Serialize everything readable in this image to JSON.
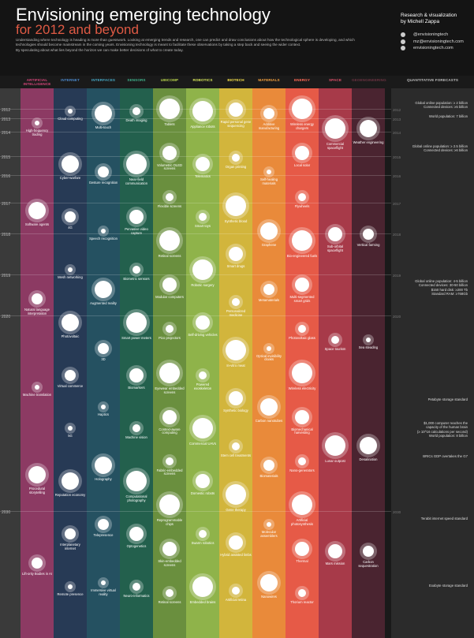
{
  "header": {
    "title": "Envisioning emerging technology",
    "subtitle": "for 2012 and beyond",
    "intro": [
      "Understanding where technology is heading is more than guesswork. Looking at emerging trends and research, one can predict and draw conclusions about how the technological sphere is developing, and which technologies should become mainstream in the coming years. Envisioning technology is meant to facilitate these observations by taking a step back and seeing the wider context.",
      "By speculating about what lies beyond the horizon we can make better decisions of what to create today."
    ],
    "credit_1": "Research & visualization",
    "credit_2": "by Michell Zappa",
    "links": [
      "@envisioningtech",
      "mz@envisioningtech.com",
      "envisioningtech.com"
    ]
  },
  "columns": [
    {
      "name": "ARTIFICIAL INTELLIGENCE",
      "color": "#8c3a63",
      "head": "#d6457a"
    },
    {
      "name": "INTERNET",
      "color": "#273a55",
      "head": "#4a86c8"
    },
    {
      "name": "INTERFACES",
      "color": "#255161",
      "head": "#45a6c2"
    },
    {
      "name": "SENSORS",
      "color": "#23604d",
      "head": "#3fb08a"
    },
    {
      "name": "UBICOMP",
      "color": "#6a8f3e",
      "head": "#b7d24b"
    },
    {
      "name": "ROBOTICS",
      "color": "#8fb34a",
      "head": "#d7e65a"
    },
    {
      "name": "BIOTECH",
      "color": "#d2b53c",
      "head": "#f5e04a"
    },
    {
      "name": "MATERIALS",
      "color": "#e98a3a",
      "head": "#f7a23e"
    },
    {
      "name": "ENERGY",
      "color": "#e65a47",
      "head": "#ff6a56"
    },
    {
      "name": "SPACE",
      "color": "#a73a49",
      "head": "#e0506a"
    },
    {
      "name": "GEOENGINEERING",
      "color": "#4a2430",
      "head": "#6a3341"
    },
    {
      "name": "QUANTITATIVE FORECASTS",
      "color": "#2b2b2b",
      "head": "#bbbbbb"
    }
  ],
  "years": [
    "2012",
    "2013",
    "2014",
    "2015",
    "2016",
    "2017",
    "2018",
    "2019",
    "2020",
    "2030"
  ],
  "techs": [
    {
      "label": "High-frequency trading",
      "col": 0
    },
    {
      "label": "Software agents",
      "col": 0
    },
    {
      "label": "Natural language interpretation",
      "col": 0
    },
    {
      "label": "Machine translation",
      "col": 0
    },
    {
      "label": "Procedural storytelling",
      "col": 0
    },
    {
      "label": "Lift-only Bodies in AI",
      "col": 0
    },
    {
      "label": "Cloud computing",
      "col": 1
    },
    {
      "label": "Cyber-warfare",
      "col": 1
    },
    {
      "label": "4G",
      "col": 1
    },
    {
      "label": "Mesh networking",
      "col": 1
    },
    {
      "label": "Photovoltaic",
      "col": 1
    },
    {
      "label": "Virtual commerce",
      "col": 1
    },
    {
      "label": "5G",
      "col": 1
    },
    {
      "label": "Reputation economy",
      "col": 1
    },
    {
      "label": "Interplanetary internet",
      "col": 1
    },
    {
      "label": "Remote presence",
      "col": 1
    },
    {
      "label": "Multi-touch",
      "col": 2
    },
    {
      "label": "Gesture recognition",
      "col": 2
    },
    {
      "label": "Speech recognition",
      "col": 2
    },
    {
      "label": "Augmented reality",
      "col": 2
    },
    {
      "label": "3D",
      "col": 2
    },
    {
      "label": "Haptics",
      "col": 2
    },
    {
      "label": "Holography",
      "col": 2
    },
    {
      "label": "Telepresence",
      "col": 2
    },
    {
      "label": "Immersive virtual reality",
      "col": 2
    },
    {
      "label": "Death imaging",
      "col": 3
    },
    {
      "label": "Near-field communication",
      "col": 3
    },
    {
      "label": "Pervasive video capture",
      "col": 3
    },
    {
      "label": "Biometric sensors",
      "col": 3
    },
    {
      "label": "Smart power meters",
      "col": 3
    },
    {
      "label": "Biomarkers",
      "col": 3
    },
    {
      "label": "Machine vision",
      "col": 3
    },
    {
      "label": "Computational photography",
      "col": 3
    },
    {
      "label": "Optogenetics",
      "col": 3
    },
    {
      "label": "Neuro-informatics",
      "col": 3
    },
    {
      "label": "Tablets",
      "col": 4
    },
    {
      "label": "Volumetric OLED screens",
      "col": 4
    },
    {
      "label": "Flexible screens",
      "col": 4
    },
    {
      "label": "Retinal screens",
      "col": 4
    },
    {
      "label": "Modular computers",
      "col": 4
    },
    {
      "label": "Pico projectors",
      "col": 4
    },
    {
      "label": "Eyewear embedded screens",
      "col": 4
    },
    {
      "label": "Context-aware computing",
      "col": 4
    },
    {
      "label": "Fabric-embedded screens",
      "col": 4
    },
    {
      "label": "Reprogrammable chips",
      "col": 4
    },
    {
      "label": "Skin-embedded screens",
      "col": 4
    },
    {
      "label": "Retinal screens",
      "col": 4
    },
    {
      "label": "Appliance robots",
      "col": 5
    },
    {
      "label": "Telematics",
      "col": 5
    },
    {
      "label": "Smart toys",
      "col": 5
    },
    {
      "label": "Robotic surgery",
      "col": 5
    },
    {
      "label": "Self-driving vehicles",
      "col": 5
    },
    {
      "label": "Powered exoskeleton",
      "col": 5
    },
    {
      "label": "Commercial UAVs",
      "col": 5
    },
    {
      "label": "Domestic robots",
      "col": 5
    },
    {
      "label": "Swarm robotics",
      "col": 5
    },
    {
      "label": "Embedded brains",
      "col": 5
    },
    {
      "label": "Rapid personal gene sequencing",
      "col": 6
    },
    {
      "label": "Organ printing",
      "col": 6
    },
    {
      "label": "Synthetic blood",
      "col": 6
    },
    {
      "label": "Smart drugs",
      "col": 6
    },
    {
      "label": "Personalized medicine",
      "col": 6
    },
    {
      "label": "In-vitro meat",
      "col": 6
    },
    {
      "label": "Synthetic biology",
      "col": 6
    },
    {
      "label": "Stem cell treatments",
      "col": 6
    },
    {
      "label": "Gene therapy",
      "col": 6
    },
    {
      "label": "Hybrid assisted limbs",
      "col": 6
    },
    {
      "label": "Artificial retina",
      "col": 6
    },
    {
      "label": "Additive manufacturing",
      "col": 7
    },
    {
      "label": "Self-healing materials",
      "col": 7
    },
    {
      "label": "Graphene",
      "col": 7
    },
    {
      "label": "Metamaterials",
      "col": 7
    },
    {
      "label": "Optical invisibility cloaks",
      "col": 7
    },
    {
      "label": "Carbon nanotubes",
      "col": 7
    },
    {
      "label": "Biomaterials",
      "col": 7
    },
    {
      "label": "Molecular assemblers",
      "col": 7
    },
    {
      "label": "Nanowires",
      "col": 7
    },
    {
      "label": "Wireless energy chargers",
      "col": 8
    },
    {
      "label": "Local solar",
      "col": 8
    },
    {
      "label": "Flywheels",
      "col": 8
    },
    {
      "label": "Bio-engineered fuels",
      "col": 8
    },
    {
      "label": "Multi-segmented smart grids",
      "col": 8
    },
    {
      "label": "Photovoltaic glass",
      "col": 8
    },
    {
      "label": "Wireless electricity",
      "col": 8
    },
    {
      "label": "Biomechanical harvesting",
      "col": 8
    },
    {
      "label": "Nano-generators",
      "col": 8
    },
    {
      "label": "Artificial photosynthesis",
      "col": 8
    },
    {
      "label": "Thermal",
      "col": 8
    },
    {
      "label": "Thorium reactor",
      "col": 8
    },
    {
      "label": "Commercial spaceflight",
      "col": 9
    },
    {
      "label": "Sub-orbital spaceflight",
      "col": 9
    },
    {
      "label": "Space tourism",
      "col": 9
    },
    {
      "label": "Lunar outpost",
      "col": 9
    },
    {
      "label": "Mars mission",
      "col": 9
    },
    {
      "label": "Weather engineering",
      "col": 10
    },
    {
      "label": "Vertical farming",
      "col": 10
    },
    {
      "label": "Sea steading",
      "col": 10
    },
    {
      "label": "Desalination",
      "col": 10
    },
    {
      "label": "Carbon sequestration",
      "col": 10
    }
  ],
  "forecasts": [
    {
      "lines": [
        "Global online population: ≥ 2 billion",
        "Connected devices: ≥5 billion"
      ]
    },
    {
      "lines": [
        "World population: 7 billion"
      ]
    },
    {
      "lines": [
        "Global online population: ≥ 2.5 billion",
        "Connected devices: ≥6 billion"
      ]
    },
    {
      "lines": [
        "Global online population: 4-5 billion",
        "Connected devices: 30-50 billion",
        "$150 hard disk: ≥200 Tb",
        "Standard RAM: ≥768Gb"
      ]
    },
    {
      "lines": [
        "Petabyte storage standard"
      ]
    },
    {
      "lines": [
        "$1,000 computer reaches the",
        "capacity of the human brain",
        "(≥ 10^16 calculations per second)"
      ]
    },
    {
      "lines": [
        "World population: 8 billion"
      ]
    },
    {
      "lines": [
        "BRICs GDP overtakes the G7"
      ]
    },
    {
      "lines": [
        "Terabit internet speed standard"
      ]
    },
    {
      "lines": [
        "Exabyte storage standard"
      ]
    }
  ]
}
